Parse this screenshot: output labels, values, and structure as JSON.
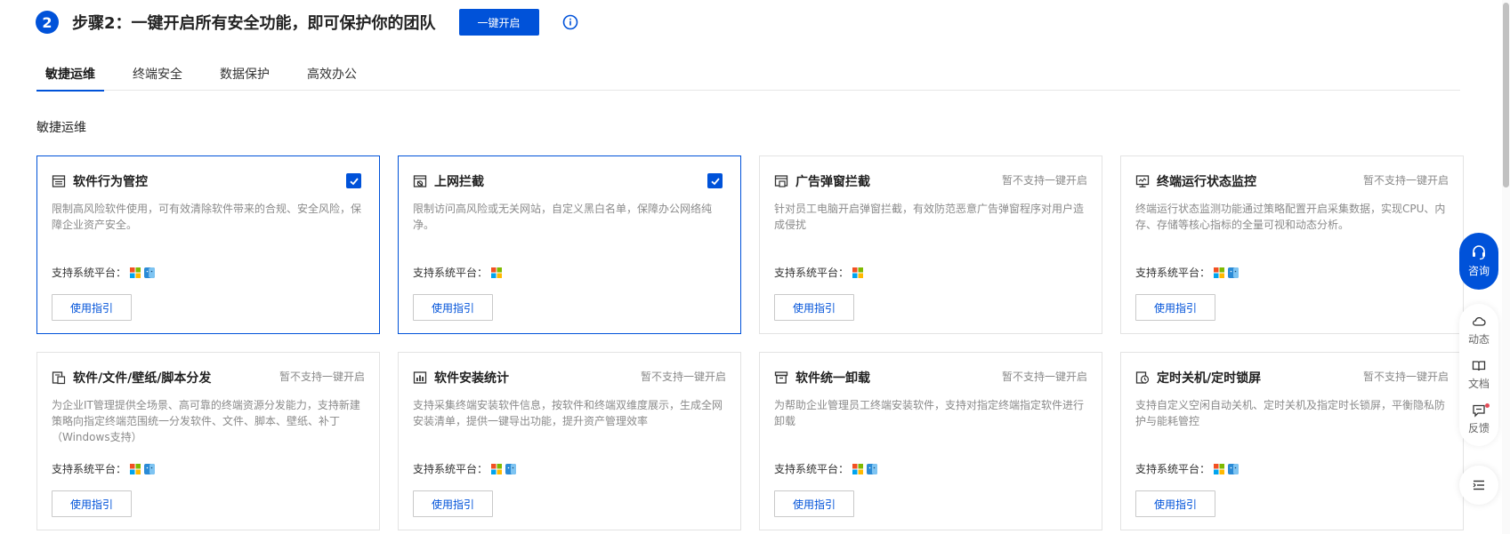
{
  "step": {
    "number": "2",
    "title": "步骤2：一键开启所有安全功能，即可保护你的团队",
    "button_label": "一键开启"
  },
  "tabs": [
    {
      "label": "敏捷运维",
      "active": true
    },
    {
      "label": "终端安全",
      "active": false
    },
    {
      "label": "数据保护",
      "active": false
    },
    {
      "label": "高效办公",
      "active": false
    }
  ],
  "section_title": "敏捷运维",
  "platform_label": "支持系统平台：",
  "guide_label": "使用指引",
  "unsupported_label": "暂不支持一键开启",
  "cards": [
    {
      "icon": "list-icon",
      "title": "软件行为管控",
      "desc": "限制高风险软件使用，可有效清除软件带来的合规、安全风险，保障企业资产安全。",
      "checked": true,
      "platforms": [
        "windows-icon",
        "mac-icon"
      ]
    },
    {
      "icon": "web-block-icon",
      "title": "上网拦截",
      "desc": "限制访问高风险或无关网站，自定义黑白名单，保障办公网络纯净。",
      "checked": true,
      "platforms": [
        "windows-icon"
      ]
    },
    {
      "icon": "popup-block-icon",
      "title": "广告弹窗拦截",
      "desc": "针对员工电脑开启弹窗拦截，有效防范恶意广告弹窗程序对用户造成侵扰",
      "checked": false,
      "platforms": [
        "windows-icon"
      ]
    },
    {
      "icon": "monitor-icon",
      "title": "终端运行状态监控",
      "desc": "终端运行状态监测功能通过策略配置开启采集数据，实现CPU、内存、存储等核心指标的全量可视和动态分析。",
      "checked": false,
      "platforms": [
        "windows-icon",
        "mac-icon"
      ]
    },
    {
      "icon": "distribute-icon",
      "title": "软件/文件/壁纸/脚本分发",
      "desc": "为企业IT管理提供全场景、高可靠的终端资源分发能力，支持新建策略向指定终端范围统一分发软件、文件、脚本、壁纸、补丁（Windows支持）",
      "checked": false,
      "platforms": [
        "windows-icon",
        "mac-icon"
      ]
    },
    {
      "icon": "stats-icon",
      "title": "软件安装统计",
      "desc": "支持采集终端安装软件信息，按软件和终端双维度展示，生成全网安装清单，提供一键导出功能，提升资产管理效率",
      "checked": false,
      "platforms": [
        "windows-icon",
        "mac-icon"
      ]
    },
    {
      "icon": "uninstall-icon",
      "title": "软件统一卸载",
      "desc": "为帮助企业管理员工终端安装软件，支持对指定终端指定软件进行卸载",
      "checked": false,
      "platforms": [
        "windows-icon",
        "mac-icon"
      ]
    },
    {
      "icon": "timer-icon",
      "title": "定时关机/定时锁屏",
      "desc": "支持自定义空闲自动关机、定时关机及指定时长锁屏，平衡隐私防护与能耗管控",
      "checked": false,
      "platforms": [
        "windows-icon",
        "mac-icon"
      ]
    }
  ],
  "rail": {
    "consult_label": "咨询",
    "items": [
      {
        "icon": "cloud-icon",
        "label": "动态"
      },
      {
        "icon": "book-icon",
        "label": "文档"
      },
      {
        "icon": "feedback-icon",
        "label": "反馈"
      }
    ],
    "menu_icon": "menu-icon"
  },
  "colors": {
    "accent": "#0052d9",
    "muted_text": "#8a8a8a",
    "notify_dot": "#e34d59"
  }
}
